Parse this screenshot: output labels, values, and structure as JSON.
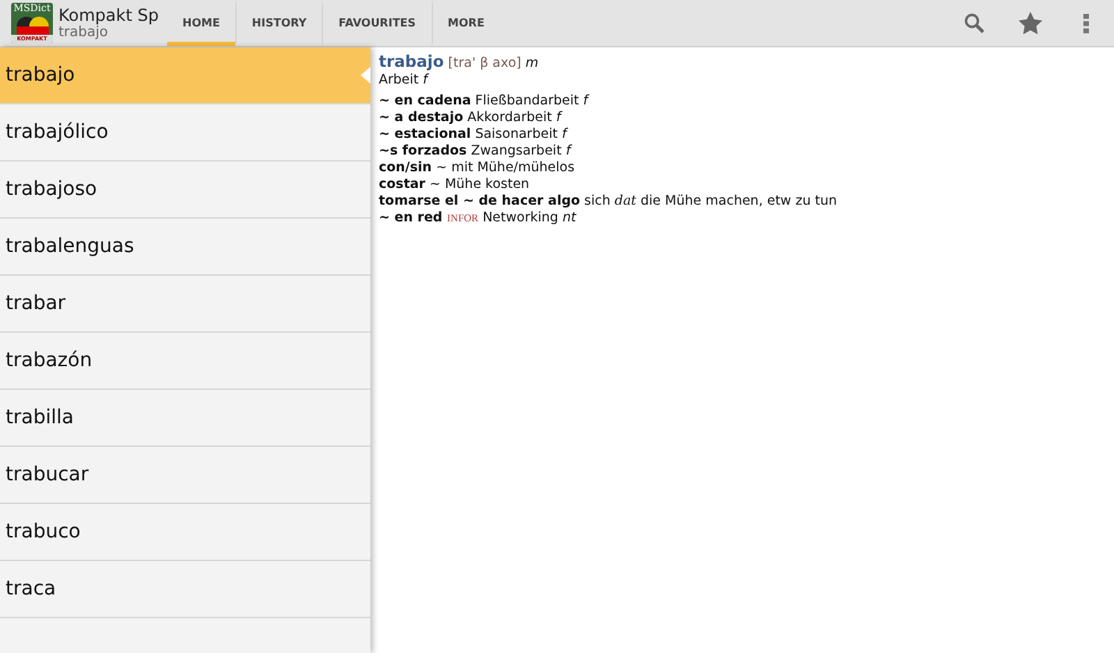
{
  "app": {
    "title": "Kompakt Sp",
    "subtitle": "trabajo",
    "logo_text": "MSDict",
    "logo_caption": "KOMPAKT"
  },
  "tabs": [
    {
      "label": "HOME",
      "selected": true
    },
    {
      "label": "HISTORY",
      "selected": false
    },
    {
      "label": "FAVOURITES",
      "selected": false
    },
    {
      "label": "MORE",
      "selected": false
    }
  ],
  "word_list": [
    {
      "word": "trabajo",
      "selected": true
    },
    {
      "word": "trabajólico",
      "selected": false
    },
    {
      "word": "trabajoso",
      "selected": false
    },
    {
      "word": "trabalenguas",
      "selected": false
    },
    {
      "word": "trabar",
      "selected": false
    },
    {
      "word": "trabazón",
      "selected": false
    },
    {
      "word": "trabilla",
      "selected": false
    },
    {
      "word": "trabucar",
      "selected": false
    },
    {
      "word": "trabuco",
      "selected": false
    },
    {
      "word": "traca",
      "selected": false
    }
  ],
  "entry": {
    "headword": "trabajo",
    "pronunciation": "[tra' β axo]",
    "gender": "m",
    "lines": [
      [
        {
          "kind": "plain",
          "text": "Arbeit "
        },
        {
          "kind": "italic",
          "text": "f"
        }
      ],
      [
        {
          "kind": "bold",
          "text": " ~ en cadena"
        },
        {
          "kind": "plain",
          "text": " Fließbandarbeit "
        },
        {
          "kind": "italic",
          "text": "f"
        }
      ],
      [
        {
          "kind": "bold",
          "text": "~ a destajo"
        },
        {
          "kind": "plain",
          "text": " Akkordarbeit "
        },
        {
          "kind": "italic",
          "text": "f"
        }
      ],
      [
        {
          "kind": "bold",
          "text": "~ estacional"
        },
        {
          "kind": "plain",
          "text": " Saisonarbeit "
        },
        {
          "kind": "italic",
          "text": "f"
        }
      ],
      [
        {
          "kind": "bold",
          "text": "~s forzados"
        },
        {
          "kind": "plain",
          "text": " Zwangsarbeit "
        },
        {
          "kind": "italic",
          "text": "f"
        }
      ],
      [
        {
          "kind": "bold",
          "text": "con/sin"
        },
        {
          "kind": "plain",
          "text": " ~ mit Mühe/mühelos"
        }
      ],
      [
        {
          "kind": "bold",
          "text": "costar"
        },
        {
          "kind": "plain",
          "text": " ~ Mühe kosten"
        }
      ],
      [
        {
          "kind": "bold",
          "text": "tomarse el ~ de hacer algo"
        },
        {
          "kind": "plain",
          "text": " sich "
        },
        {
          "kind": "grammar",
          "text": "dat"
        },
        {
          "kind": "plain",
          "text": " die Mühe machen, etw zu tun"
        }
      ],
      [
        {
          "kind": "bold",
          "text": "~ en red "
        },
        {
          "kind": "label",
          "text": "INFOR"
        },
        {
          "kind": "plain",
          "text": " Networking "
        },
        {
          "kind": "italic",
          "text": "nt"
        }
      ]
    ]
  }
}
